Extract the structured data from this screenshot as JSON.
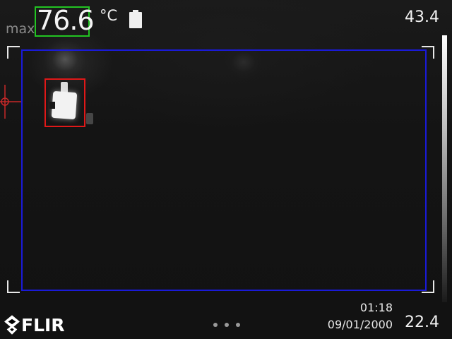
{
  "hud": {
    "max_label": "max",
    "max_value": "76.6",
    "unit": "°C",
    "battery_icon": "battery-icon"
  },
  "scale": {
    "top_value": "43.4",
    "bottom_value": "22.4"
  },
  "footer": {
    "logo_text": "FLIR",
    "logo_icon": "flir-diamond-icon",
    "menu_icon": "more-dots-icon",
    "time": "01:18",
    "date": "09/01/2000"
  },
  "colors": {
    "measure_box": "#1a1ad8",
    "hot_spot_box": "#e01818",
    "max_value_box": "#22c422",
    "crosshair": "#c62828"
  }
}
